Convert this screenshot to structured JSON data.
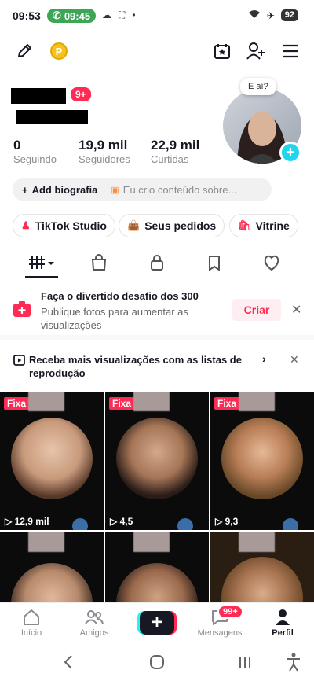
{
  "status_bar": {
    "time": "09:53",
    "call_time": "09:45",
    "battery": "92"
  },
  "profile": {
    "notif_badge": "9+",
    "stats": [
      {
        "value": "0",
        "label": "Seguindo"
      },
      {
        "value": "19,9 mil",
        "label": "Seguidores"
      },
      {
        "value": "22,9 mil",
        "label": "Curtidas"
      }
    ],
    "avatar_bubble": "E aí?",
    "add_bio": "Add biografia",
    "bio_placeholder": "Eu crio conteúdo sobre..."
  },
  "chips": [
    {
      "label": "TikTok Studio",
      "icon": "person-icon"
    },
    {
      "label": "Seus pedidos",
      "icon": "bag-icon"
    },
    {
      "label": "Vitrine",
      "icon": "shop-icon"
    }
  ],
  "banner_challenge": {
    "title": "Faça o divertido desafio dos 300",
    "subtitle": "Publique fotos para aumentar as visualizações",
    "action": "Criar"
  },
  "banner_playlist": {
    "text": "Receba mais visualizações com as listas de reprodução"
  },
  "videos": [
    {
      "pinned": "Fixa",
      "views": "12,9 mil"
    },
    {
      "pinned": "Fixa",
      "views": "4,5"
    },
    {
      "pinned": "Fixa",
      "views": "9,3"
    },
    {
      "pinned": "",
      "views": ""
    },
    {
      "pinned": "",
      "views": ""
    },
    {
      "pinned": "",
      "views": ""
    }
  ],
  "bottom_nav": {
    "home": "Início",
    "friends": "Amigos",
    "messages": "Mensagens",
    "messages_badge": "99+",
    "profile": "Perfil"
  },
  "colors": {
    "accent": "#fe2c55",
    "cyan": "#20d5ec",
    "text": "#161823",
    "muted": "#8a8b91"
  }
}
